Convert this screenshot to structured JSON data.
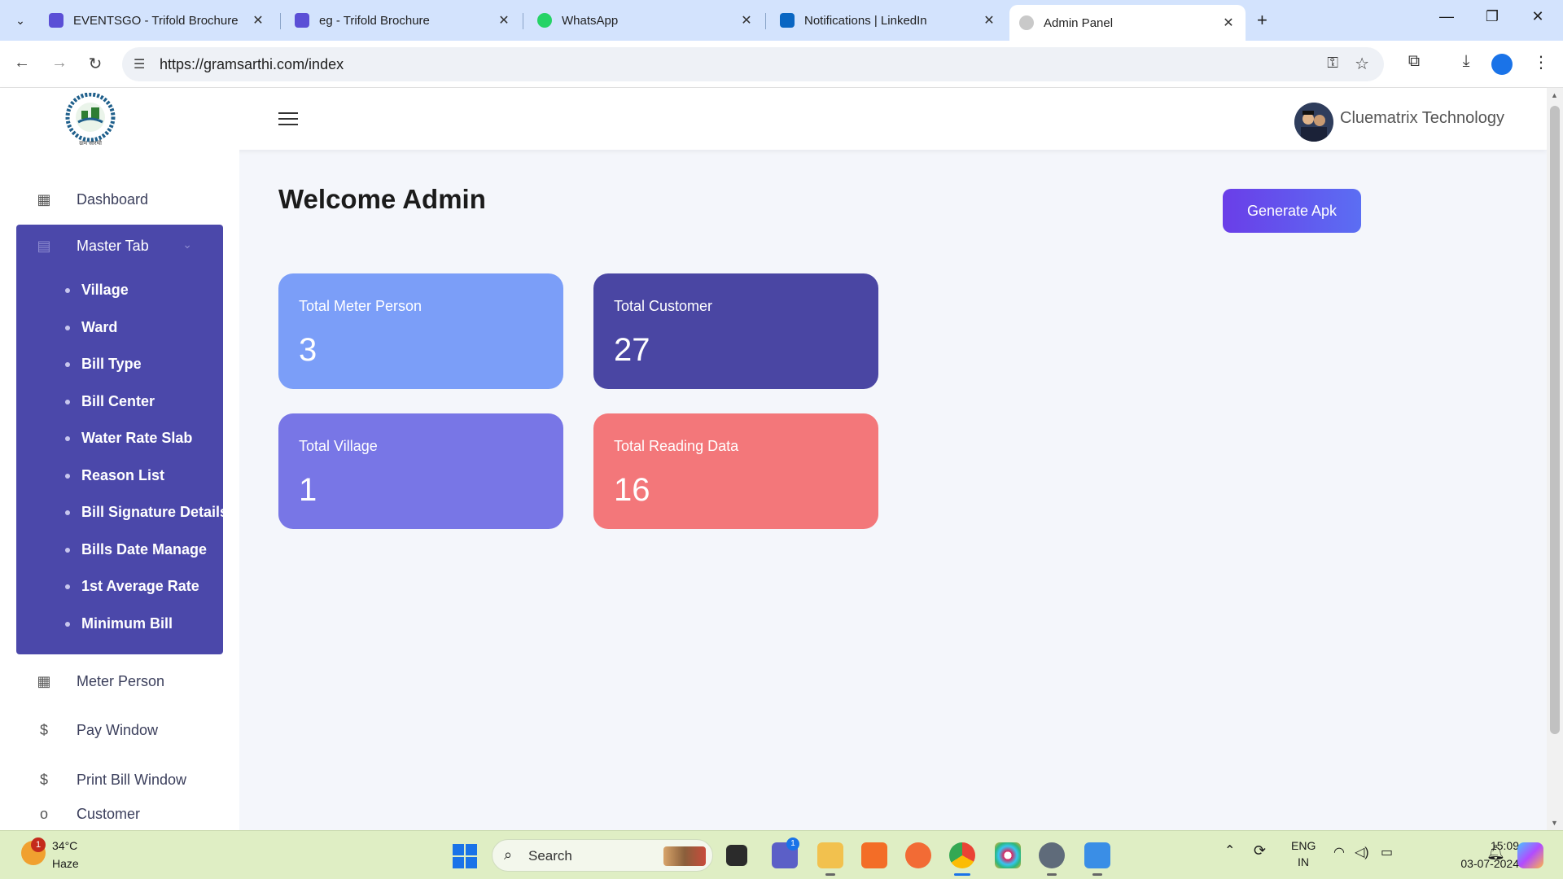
{
  "browser": {
    "tabs": [
      {
        "title": "EVENTSGO - Trifold Brochure",
        "favicon_color": "#5b4fd6"
      },
      {
        "title": "eg - Trifold Brochure",
        "favicon_color": "#5b4fd6"
      },
      {
        "title": "WhatsApp",
        "favicon_color": "#25d366"
      },
      {
        "title": "Notifications | LinkedIn",
        "favicon_color": "#0a66c2"
      },
      {
        "title": "Admin Panel",
        "favicon_color": "#c9c9c9"
      }
    ],
    "url": "https://gramsarthi.com/index"
  },
  "header": {
    "org_name": "Cluematrix Technology",
    "logo_caption": "ग्राम सारथी"
  },
  "sidebar": {
    "dashboard": "Dashboard",
    "master_tab": "Master Tab",
    "master_items": [
      "Village",
      "Ward",
      "Bill Type",
      "Bill Center",
      "Water Rate Slab",
      "Reason List",
      "Bill Signature Details",
      "Bills Date Manage",
      "1st Average Rate",
      "Minimum Bill"
    ],
    "meter_person": "Meter Person",
    "pay_window": "Pay Window",
    "print_bill_window": "Print Bill Window",
    "customer": "Customer"
  },
  "main": {
    "welcome": "Welcome Admin",
    "generate_apk": "Generate Apk",
    "cards": [
      {
        "label": "Total Meter Person",
        "value": "3",
        "color": "#7b9ef8"
      },
      {
        "label": "Total Customer",
        "value": "27",
        "color": "#4a46a3"
      },
      {
        "label": "Total Village",
        "value": "1",
        "color": "#7876e6"
      },
      {
        "label": "Total Reading Data",
        "value": "16",
        "color": "#f3777a"
      }
    ]
  },
  "taskbar": {
    "weather_temp": "34°C",
    "weather_desc": "Haze",
    "weather_badge": "1",
    "search_label": "Search",
    "lang_top": "ENG",
    "lang_bottom": "IN",
    "time": "15:09",
    "date": "03-07-2024",
    "teams_badge": "1"
  }
}
